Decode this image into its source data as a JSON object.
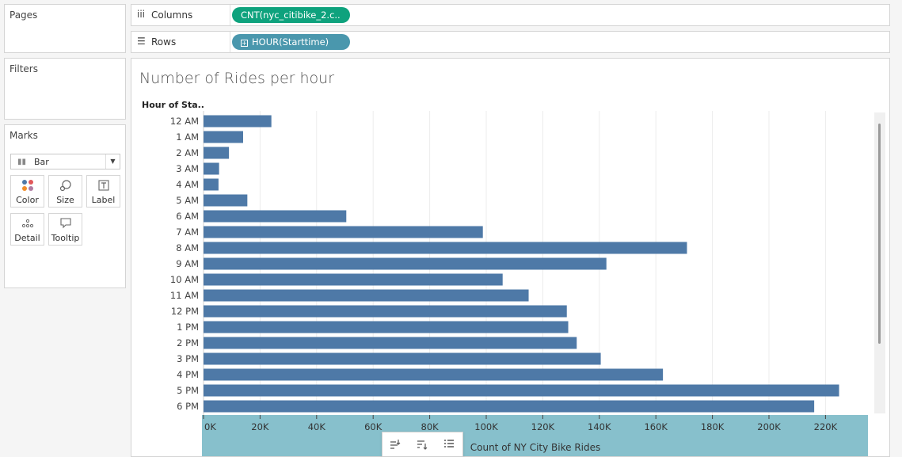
{
  "sidebar": {
    "pages_title": "Pages",
    "filters_title": "Filters",
    "marks_title": "Marks",
    "mark_type": "Bar",
    "mark_buttons": [
      {
        "label": "Color",
        "icon": "color-dots-icon"
      },
      {
        "label": "Size",
        "icon": "size-icon"
      },
      {
        "label": "Label",
        "icon": "text-label-icon"
      },
      {
        "label": "Detail",
        "icon": "detail-dots-icon"
      },
      {
        "label": "Tooltip",
        "icon": "tooltip-icon"
      }
    ]
  },
  "shelves": {
    "columns_label": "Columns",
    "columns_pill": "CNT(nyc_citibike_2.c..",
    "rows_label": "Rows",
    "rows_pill": "HOUR(Starttime)",
    "pill_plus": "+"
  },
  "view": {
    "title": "Number of Rides per hour",
    "row_header": "Hour of Sta.."
  },
  "colors": {
    "bar": "#4e79a7",
    "axis_band": "#87c0cc",
    "columns_pill": "#0ea27d",
    "rows_pill": "#4a97ad"
  },
  "chart_data": {
    "type": "bar",
    "orientation": "horizontal",
    "categories": [
      "12 AM",
      "1 AM",
      "2 AM",
      "3 AM",
      "4 AM",
      "5 AM",
      "6 AM",
      "7 AM",
      "8 AM",
      "9 AM",
      "10 AM",
      "11 AM",
      "12 PM",
      "1 PM",
      "2 PM",
      "3 PM",
      "4 PM",
      "5 PM",
      "6 PM"
    ],
    "values": [
      24000,
      14000,
      9000,
      5500,
      5300,
      15500,
      50500,
      98800,
      171000,
      142500,
      105800,
      115000,
      128500,
      129000,
      132000,
      140500,
      162500,
      224800,
      216000
    ],
    "xlabel": "Count of NY City Bike Rides",
    "ylabel": "Hour of Sta..",
    "xlim": [
      0,
      230000
    ],
    "xticks": [
      0,
      20000,
      40000,
      60000,
      80000,
      100000,
      120000,
      140000,
      160000,
      180000,
      200000,
      220000
    ],
    "xtick_labels": [
      "0K",
      "20K",
      "40K",
      "60K",
      "80K",
      "100K",
      "120K",
      "140K",
      "160K",
      "180K",
      "200K",
      "220K"
    ],
    "grid": true
  },
  "toolbar": [
    "swap-axes-icon",
    "sort-icon",
    "show-labels-icon"
  ]
}
